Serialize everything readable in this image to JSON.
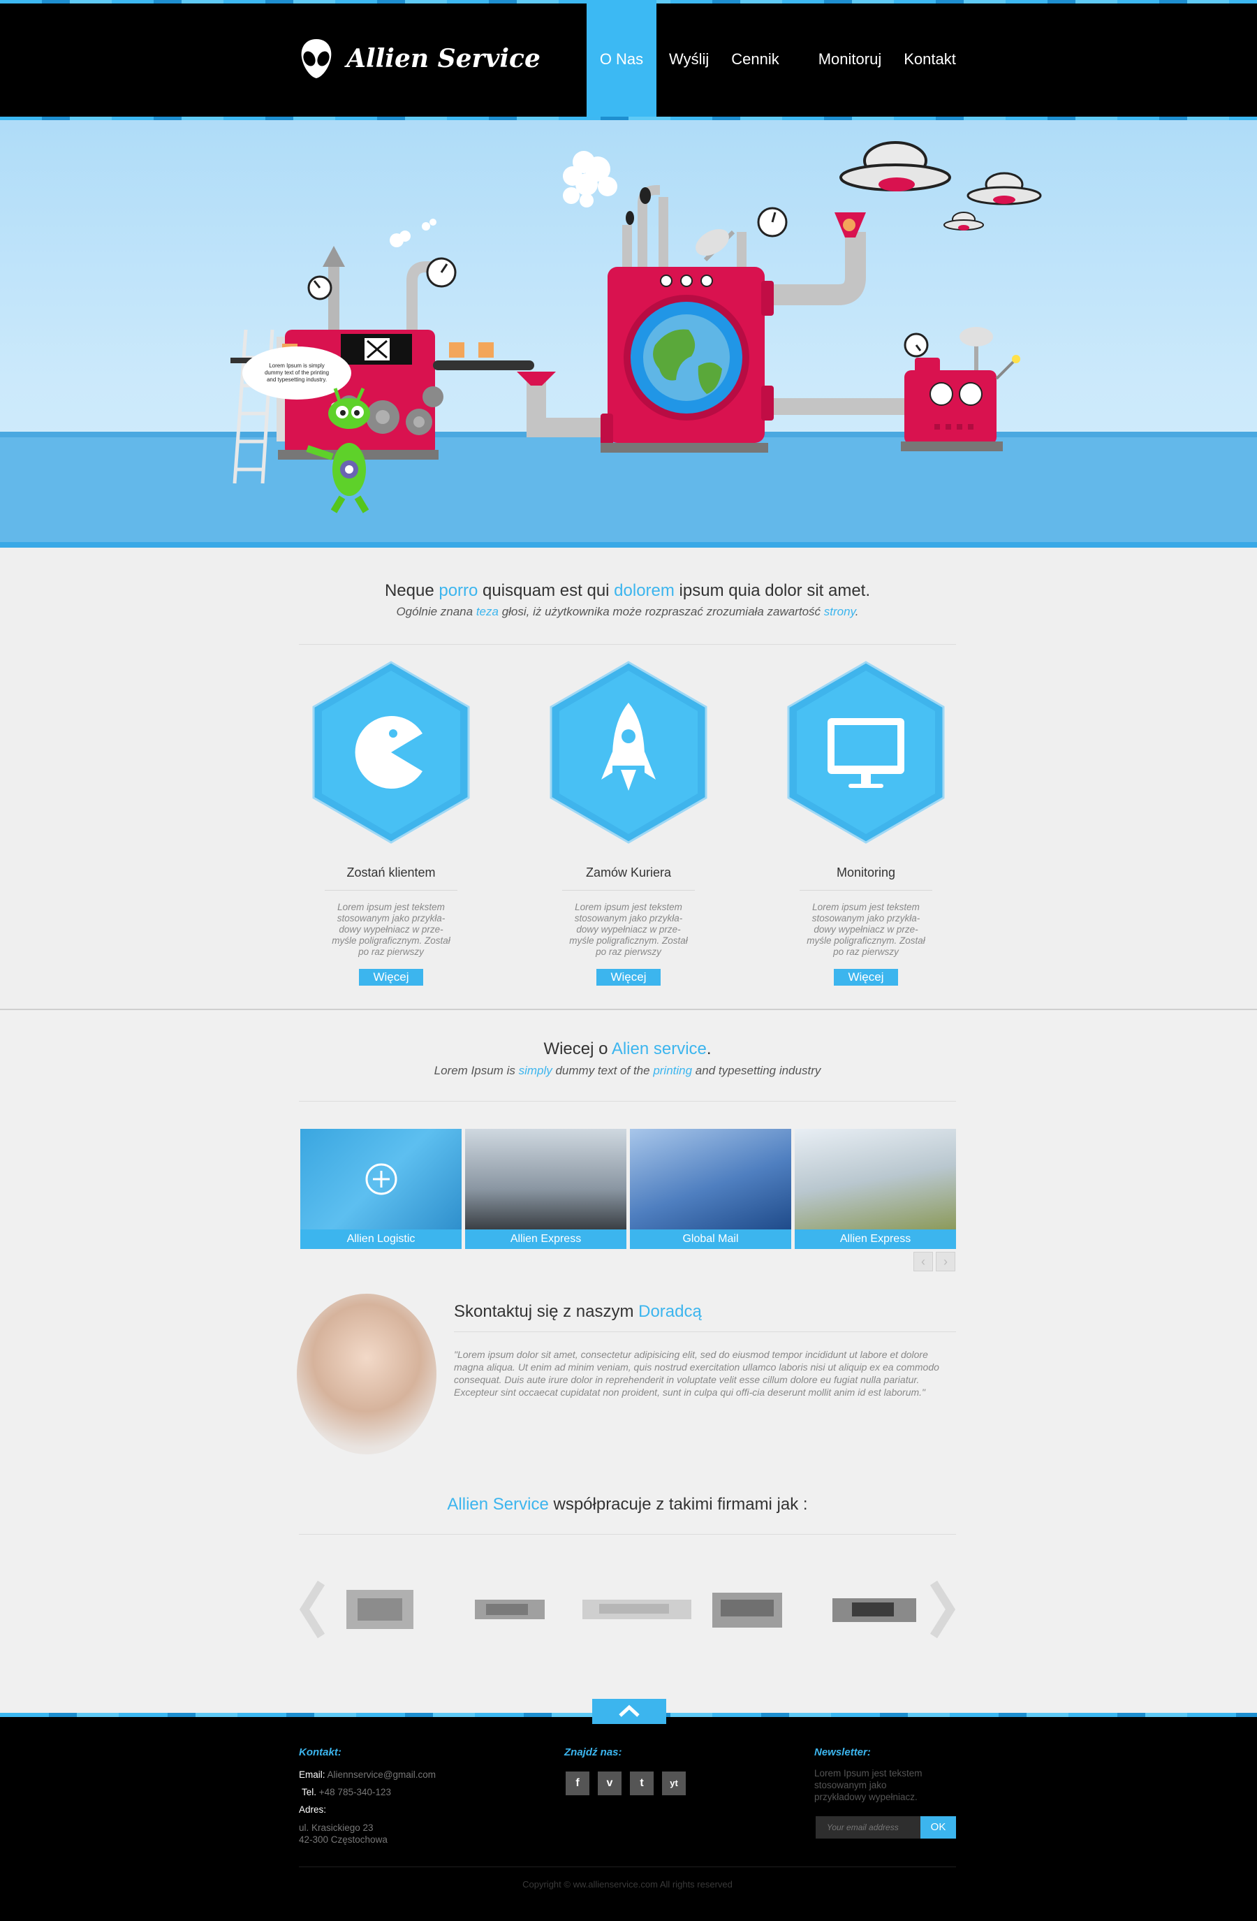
{
  "header": {
    "brand": "Allien Service",
    "nav": [
      {
        "label": "O Nas",
        "active": true
      },
      {
        "label": "Wyślij"
      },
      {
        "label": "Cennik"
      },
      {
        "label": "Monitoruj"
      },
      {
        "label": "Kontakt"
      }
    ]
  },
  "hero": {
    "bubble_text": "Lorem Ipsum is simply dummy text of the printing and typesetting industry. Lorem Ipsum has been the"
  },
  "intro": {
    "title_parts": [
      "Neque ",
      "porro",
      " quisquam est qui ",
      "dolorem",
      " ipsum quia dolor sit amet."
    ],
    "subtitle_parts": [
      "Ogólnie znana ",
      "teza",
      " głosi, iż użytkownika może rozpraszać zrozumiała zawartość ",
      "strony",
      "."
    ]
  },
  "features": [
    {
      "icon": "pacman-icon",
      "title": "Zostań klientem",
      "text": "Lorem ipsum jest tekstem stosowanym jako przykła-dowy wypełniacz w prze-myśle poligraficznym. Został po raz pierwszy",
      "button": "Więcej"
    },
    {
      "icon": "rocket-icon",
      "title": "Zamów Kuriera",
      "text": "Lorem ipsum jest tekstem stosowanym jako przykła-dowy wypełniacz w prze-myśle poligraficznym. Został po raz pierwszy",
      "button": "Więcej"
    },
    {
      "icon": "monitor-icon",
      "title": "Monitoring",
      "text": "Lorem ipsum jest tekstem stosowanym jako przykła-dowy wypełniacz w prze-myśle poligraficznym. Został po raz pierwszy",
      "button": "Więcej"
    }
  ],
  "more": {
    "title_parts": [
      "Wiecej o ",
      "Alien service",
      "."
    ],
    "subtitle_parts": [
      "Lorem Ipsum is ",
      "simply",
      " dummy text of the ",
      "printing",
      " and typesetting industry"
    ],
    "tiles": [
      {
        "caption": "Allien Logistic"
      },
      {
        "caption": "Allien Express"
      },
      {
        "caption": "Global Mail"
      },
      {
        "caption": "Allien Express"
      }
    ],
    "prev": "‹",
    "next": "›"
  },
  "advisor": {
    "title_parts": [
      "Skontaktuj się z naszym ",
      "Doradcą"
    ],
    "quote": "\"Lorem ipsum dolor sit amet, consectetur adipisicing elit, sed do eiusmod tempor incididunt ut labore et dolore magna aliqua. Ut enim ad minim veniam, quis nostrud exercitation ullamco laboris nisi ut aliquip ex ea commodo consequat. Duis aute irure dolor in reprehenderit in voluptate velit esse cillum dolore eu fugiat nulla pariatur. Excepteur sint occaecat cupidatat non proident, sunt in culpa qui offi-cia deserunt mollit anim id est laborum.\""
  },
  "partners": {
    "title_parts": [
      "Allien Service",
      " współpracuje z takimi firmami jak :"
    ]
  },
  "footer": {
    "contact_title": "Kontakt:",
    "email_label": "Email:",
    "email": "Aliennservice@gmail.com",
    "tel_label": "Tel.",
    "tel": "+48 785-340-123",
    "addr_label": "Adres:",
    "addr1": "ul. Krasickiego 23",
    "addr2": "42-300 Częstochowa",
    "find_title": "Znajdź nas:",
    "social": [
      "f",
      "v",
      "t",
      "yt"
    ],
    "newsletter_title": "Newsletter:",
    "newsletter_text": "Lorem Ipsum jest tekstem stosowanym jako przykładowy wypełniacz.",
    "newsletter_placeholder": "Your email address",
    "newsletter_button": "OK",
    "copyright": "Copyright © ww.allienservice.com All rights reserved"
  },
  "colors": {
    "accent": "#3cb5ee",
    "header_bg": "#000000",
    "machine": "#d9124f"
  }
}
